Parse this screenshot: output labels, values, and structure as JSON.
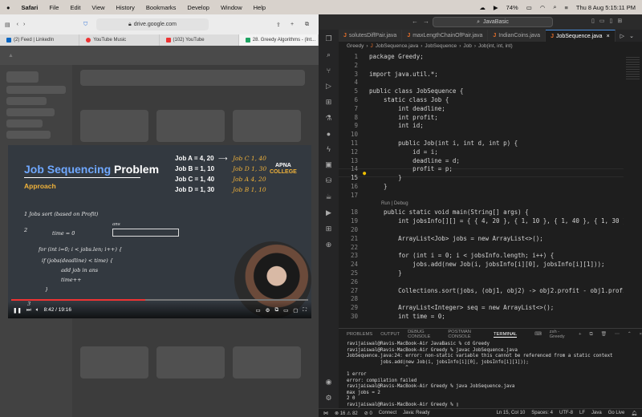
{
  "menubar": {
    "apple": "",
    "items": [
      "Safari",
      "File",
      "Edit",
      "View",
      "History",
      "Bookmarks",
      "Develop",
      "Window",
      "Help"
    ],
    "battery": "74%",
    "datetime": "Thu 8 Aug  5:15:11 PM"
  },
  "safari": {
    "address": "drive.google.com",
    "tabs": [
      {
        "label": "(2) Feed | LinkedIn",
        "color": "#0a66c2"
      },
      {
        "label": "YouTube Music",
        "color": "#e33"
      },
      {
        "label": "(102) YouTube",
        "color": "#e33"
      },
      {
        "label": "28. Greedy Algorithms - (Int...",
        "color": "#1fa463"
      }
    ]
  },
  "video": {
    "title_blue": "Job Sequencing",
    "title_white": "Problem",
    "approach": "Approach",
    "jobs": [
      "Job A = 4, 20",
      "Job B = 1, 10",
      "Job C = 1, 40",
      "Job D = 1, 30"
    ],
    "sorted": [
      "Job C   1, 40",
      "Job D   1, 30",
      "Job A   4, 20",
      "Job B   1, 10"
    ],
    "brand_top": "APNA",
    "brand_bottom": "COLLEGE",
    "note1": "1   Jobs sort (based on Profit)",
    "note2": "2",
    "note_ans": "ans",
    "note_time": "time = 0",
    "note_for": "for (int i=0; i < jobs.len; i++) {",
    "note_if": "if (jobs(deadline) < time) {",
    "note_add": "add job in ans",
    "note_time2": "time++",
    "note_close": "}",
    "note3": "3",
    "time": "8:42 / 19:16"
  },
  "vscode": {
    "command_center": "JavaBasic",
    "tabs": [
      {
        "label": "solutesDiffPair.java",
        "active": false
      },
      {
        "label": "maxLengthChainOfPair.java",
        "active": false
      },
      {
        "label": "IndianCoins.java",
        "active": false
      },
      {
        "label": "JobSequence.java",
        "active": true
      }
    ],
    "breadcrumb": [
      "Greedy",
      "JobSequence.java",
      "JobSequence",
      "Job",
      "Job(int, int, int)"
    ],
    "lines": [
      {
        "n": "1",
        "c": "package Greedy;"
      },
      {
        "n": "2",
        "c": ""
      },
      {
        "n": "3",
        "c": "import java.util.*;"
      },
      {
        "n": "4",
        "c": ""
      },
      {
        "n": "5",
        "c": "public class JobSequence {"
      },
      {
        "n": "6",
        "c": "    static class Job {"
      },
      {
        "n": "7",
        "c": "        int deadline;"
      },
      {
        "n": "8",
        "c": "        int profit;"
      },
      {
        "n": "9",
        "c": "        int id;"
      },
      {
        "n": "10",
        "c": ""
      },
      {
        "n": "11",
        "c": "        public Job(int i, int d, int p) {"
      },
      {
        "n": "12",
        "c": "            id = i;"
      },
      {
        "n": "13",
        "c": "            deadline = d;"
      },
      {
        "n": "14",
        "c": "            profit = p;"
      },
      {
        "n": "15",
        "c": "        }"
      },
      {
        "n": "16",
        "c": "    }"
      },
      {
        "n": "17",
        "c": ""
      },
      {
        "n": "18",
        "c": "    public static void main(String[] args) {"
      },
      {
        "n": "19",
        "c": "        int jobsInfo[][] = { { 4, 20 }, { 1, 10 }, { 1, 40 }, { 1, 30 }"
      },
      {
        "n": "20",
        "c": ""
      },
      {
        "n": "21",
        "c": "        ArrayList<Job> jobs = new ArrayList<>();"
      },
      {
        "n": "22",
        "c": ""
      },
      {
        "n": "23",
        "c": "        for (int i = 0; i < jobsInfo.length; i++) {"
      },
      {
        "n": "24",
        "c": "            jobs.add(new Job(i, jobsInfo[i][0], jobsInfo[i][1]));"
      },
      {
        "n": "25",
        "c": "        }"
      },
      {
        "n": "26",
        "c": ""
      },
      {
        "n": "27",
        "c": "        Collections.sort(jobs, (obj1, obj2) -> obj2.profit - obj1.profi"
      },
      {
        "n": "28",
        "c": ""
      },
      {
        "n": "29",
        "c": "        ArrayList<Integer> seq = new ArrayList<>();"
      },
      {
        "n": "30",
        "c": "        int time = 0;"
      }
    ],
    "run_debug": "Run | Debug",
    "panel_tabs": [
      "PROBLEMS",
      "OUTPUT",
      "DEBUG CONSOLE",
      "POSTMAN CONSOLE",
      "TERMINAL"
    ],
    "terminal_shell": "zsh - Greedy",
    "terminal": [
      "ravijaiswal@Ravis-MacBook-Air JavaBasic % cd Greedy",
      "ravijaiswal@Ravis-MacBook-Air Greedy % javac JobSequence.java",
      "JobSequence.java:24: error: non-static variable this cannot be referenced from a static context",
      "            jobs.add(new Job(i, jobsInfo[i][0], jobsInfo[i][1]));",
      "                     ^",
      "1 error",
      "error: compilation failed",
      "ravijaiswal@Ravis-MacBook-Air Greedy % java JobSequence.java",
      "max jobs = 2",
      "2 0",
      "ravijaiswal@Ravis-MacBook-Air Greedy % ▯"
    ],
    "status": {
      "problems": "⊗ 16 ⚠ 82",
      "ports": "⊘ 0",
      "connect": "Connect",
      "java": "Java: Ready",
      "position": "Ln 15, Col 10",
      "spaces": "Spaces: 4",
      "encoding": "UTF-8",
      "eol": "LF",
      "lang": "Java",
      "golive": "Go Live"
    }
  }
}
